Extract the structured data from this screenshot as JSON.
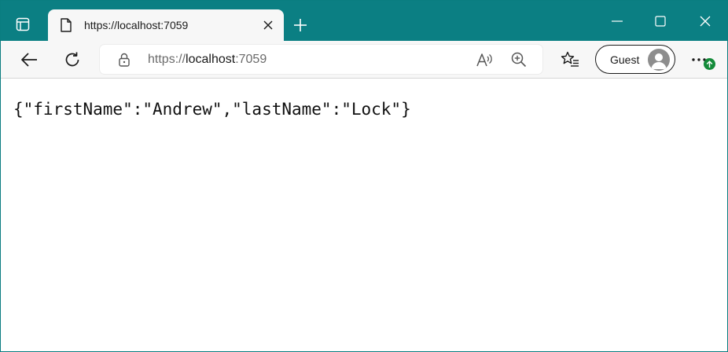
{
  "browser": {
    "tab": {
      "title": "https://localhost:7059"
    },
    "address_bar": {
      "scheme": "https://",
      "host": "localhost",
      "port": ":7059"
    },
    "profile": {
      "label": "Guest"
    },
    "colors": {
      "titlebar": "#0b7f83",
      "toolbar": "#f7f7f7",
      "update_badge": "#148b3a"
    },
    "icons": [
      "tab-actions-icon",
      "page-icon",
      "close-icon",
      "plus-icon",
      "minimize-icon",
      "maximize-icon",
      "window-close-icon",
      "back-arrow-icon",
      "refresh-icon",
      "lock-icon",
      "read-aloud-icon",
      "zoom-icon",
      "favorites-icon",
      "avatar-icon",
      "more-icon",
      "update-arrow-icon"
    ]
  },
  "page": {
    "json_text": "{\"firstName\":\"Andrew\",\"lastName\":\"Lock\"}"
  }
}
